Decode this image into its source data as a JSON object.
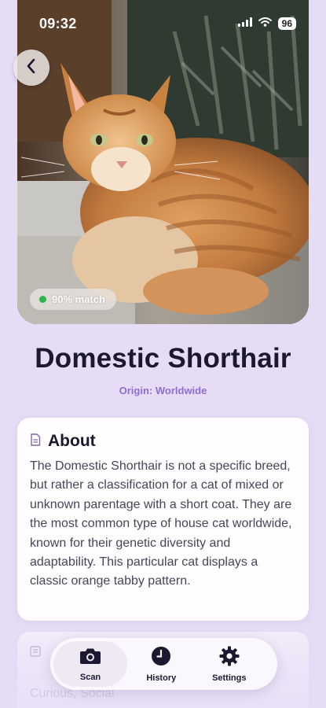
{
  "status_bar": {
    "time": "09:32",
    "battery": "96",
    "icons": [
      "signal-icon",
      "wifi-icon",
      "battery-icon"
    ]
  },
  "nav": {
    "back_icon": "chevron-left-icon"
  },
  "hero": {
    "image": "orange tabby cat lying on couch",
    "match_label": "90% match",
    "match_color": "#2fb34a"
  },
  "breed": {
    "name": "Domestic Shorthair",
    "origin": "Origin: Worldwide"
  },
  "about": {
    "icon": "document-icon",
    "title": "About",
    "text": "The Domestic Shorthair is not a specific breed, but rather a classification for a cat of mixed or unknown parentage with a short coat. They are the most common type of house cat worldwide, known for their genetic diversity and adaptability. This particular cat displays a classic orange tabby pattern."
  },
  "traits": {
    "icon": "list-icon",
    "text": "Curious, Social"
  },
  "tabbar": {
    "tabs": [
      {
        "label": "Scan",
        "icon": "camera-icon",
        "active": true
      },
      {
        "label": "History",
        "icon": "clock-icon",
        "active": false
      },
      {
        "label": "Settings",
        "icon": "gear-icon",
        "active": false
      }
    ]
  },
  "colors": {
    "background": "#e6dcf6",
    "accent": "#8c6fd0",
    "title": "#1c1830"
  }
}
